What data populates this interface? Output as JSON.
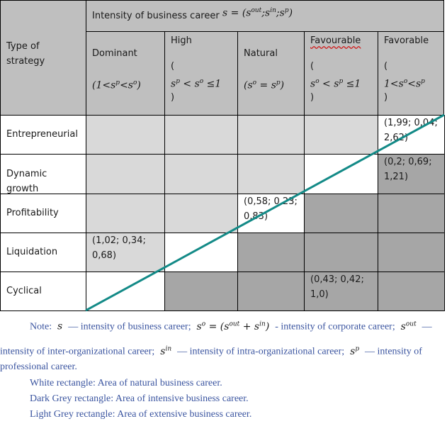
{
  "table": {
    "corner_label": "Type of strategy",
    "header_title": "Intensity of business career",
    "header_formula": "s = (s^out; s^in; s^p)",
    "columns": [
      {
        "label": "Dominant",
        "formula": "(1<s^p<s^o)"
      },
      {
        "label": "High",
        "formula": "(s^p < s^o ≤1)"
      },
      {
        "label": "Natural",
        "formula": "(s^o = s^p)"
      },
      {
        "label": "Favourable",
        "formula": "(s^o < s^p ≤1)",
        "spellcheck_flag": true
      },
      {
        "label": "Favorable",
        "formula": "(1<s^o<s^p)"
      }
    ],
    "rows": [
      {
        "label": "Entrepreneurial",
        "cells": [
          {
            "shade": "light",
            "value": ""
          },
          {
            "shade": "light",
            "value": ""
          },
          {
            "shade": "light",
            "value": ""
          },
          {
            "shade": "light",
            "value": ""
          },
          {
            "shade": "white",
            "value": "(1,99; 0,04; 2,62)"
          }
        ]
      },
      {
        "label": "Dynamic growth",
        "cells": [
          {
            "shade": "light",
            "value": ""
          },
          {
            "shade": "light",
            "value": ""
          },
          {
            "shade": "light",
            "value": ""
          },
          {
            "shade": "white",
            "value": ""
          },
          {
            "shade": "dark",
            "value": "(0,2; 0,69; 1,21)"
          }
        ]
      },
      {
        "label": "Profitability",
        "cells": [
          {
            "shade": "light",
            "value": ""
          },
          {
            "shade": "light",
            "value": ""
          },
          {
            "shade": "white",
            "value": "(0,58; 0,23; 0,83)"
          },
          {
            "shade": "dark",
            "value": ""
          },
          {
            "shade": "dark",
            "value": ""
          }
        ]
      },
      {
        "label": "Liquidation",
        "cells": [
          {
            "shade": "light",
            "value": "(1,02; 0,34; 0,68)"
          },
          {
            "shade": "white",
            "value": ""
          },
          {
            "shade": "dark",
            "value": ""
          },
          {
            "shade": "dark",
            "value": ""
          },
          {
            "shade": "dark",
            "value": ""
          }
        ]
      },
      {
        "label": "Cyclical",
        "cells": [
          {
            "shade": "white",
            "value": ""
          },
          {
            "shade": "dark",
            "value": ""
          },
          {
            "shade": "dark",
            "value": ""
          },
          {
            "shade": "dark",
            "value": "(0,43; 0,42; 1,0)"
          },
          {
            "shade": "dark",
            "value": ""
          }
        ]
      }
    ],
    "diagonal_color": "#138a87",
    "colors": {
      "header": "#bfbfbf",
      "light": "#d9d9d9",
      "dark": "#a6a6a6",
      "white": "#ffffff"
    }
  },
  "note": {
    "prefix": "Note:",
    "s_def": "— intensity of business career;",
    "so_def": "- intensity of corporate career;",
    "sout_def_1": "—",
    "sout_def_2": "intensity of inter-organizational career;",
    "sin_def": "— intensity of intra-organizational career;",
    "sp_def_1": "— intensity of",
    "sp_def_2": "professional career.",
    "legend": [
      "White rectangle: Area of natural business career.",
      "Dark Grey rectangle: Area of intensive business career.",
      "Light Grey rectangle: Area of extensive business career."
    ]
  }
}
